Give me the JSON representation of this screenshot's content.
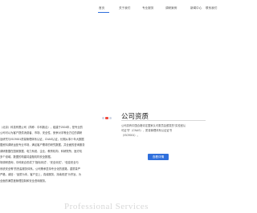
{
  "nav": {
    "items": [
      {
        "label": "首页"
      },
      {
        "label": "关于我们"
      },
      {
        "label": "专业服务"
      },
      {
        "label": "调研案例"
      },
      {
        "label": "新闻中心"
      },
      {
        "label": "联系我们"
      }
    ]
  },
  "about": {
    "lines": [
      "（北京）科技有限公司（简称：中科致合），组建于2004年，是专业的",
      "公司可以为客户提供消费者、市场、安全性、竞争对手等全方位的调研",
      "及研究与ISO9001质量管理体系认证，CNAS认证，长期从事十年大数据",
      "据资料调研运营专业市场，满足客户需求的研究数据，并全面的咨询服务",
      "调研数据在国家数据、电力系统、企业、教育机构、科研院所、医疗机",
      "多个领域。数据的构建将金融机构安全数据。",
      "场调研咨询，中科致合形成了“指标测试”、“安全测试”、“信息安全与",
      "系统安全等”的完善服务体系。公司秉承坚持专业化的道路，重质量严",
      "严格，诚信：“品质为本，客户至上，真诚服务，持续改进”为宗旨，为",
      "全面的满意度管理控制和安全咨询服务。"
    ]
  },
  "qualification": {
    "title": "公司资质",
    "lines": [
      "公司具有中国合格评定国家认可委员会颁发的“实验室认",
      "可证书”（CNAS）、质量管理体系认证证书",
      "（ISO9001）。"
    ],
    "more_label": "查看详情"
  },
  "services": {
    "heading": "Professional Services"
  },
  "colors": {
    "accent": "#2f6fdc",
    "dot_active": "#f04a3e"
  }
}
